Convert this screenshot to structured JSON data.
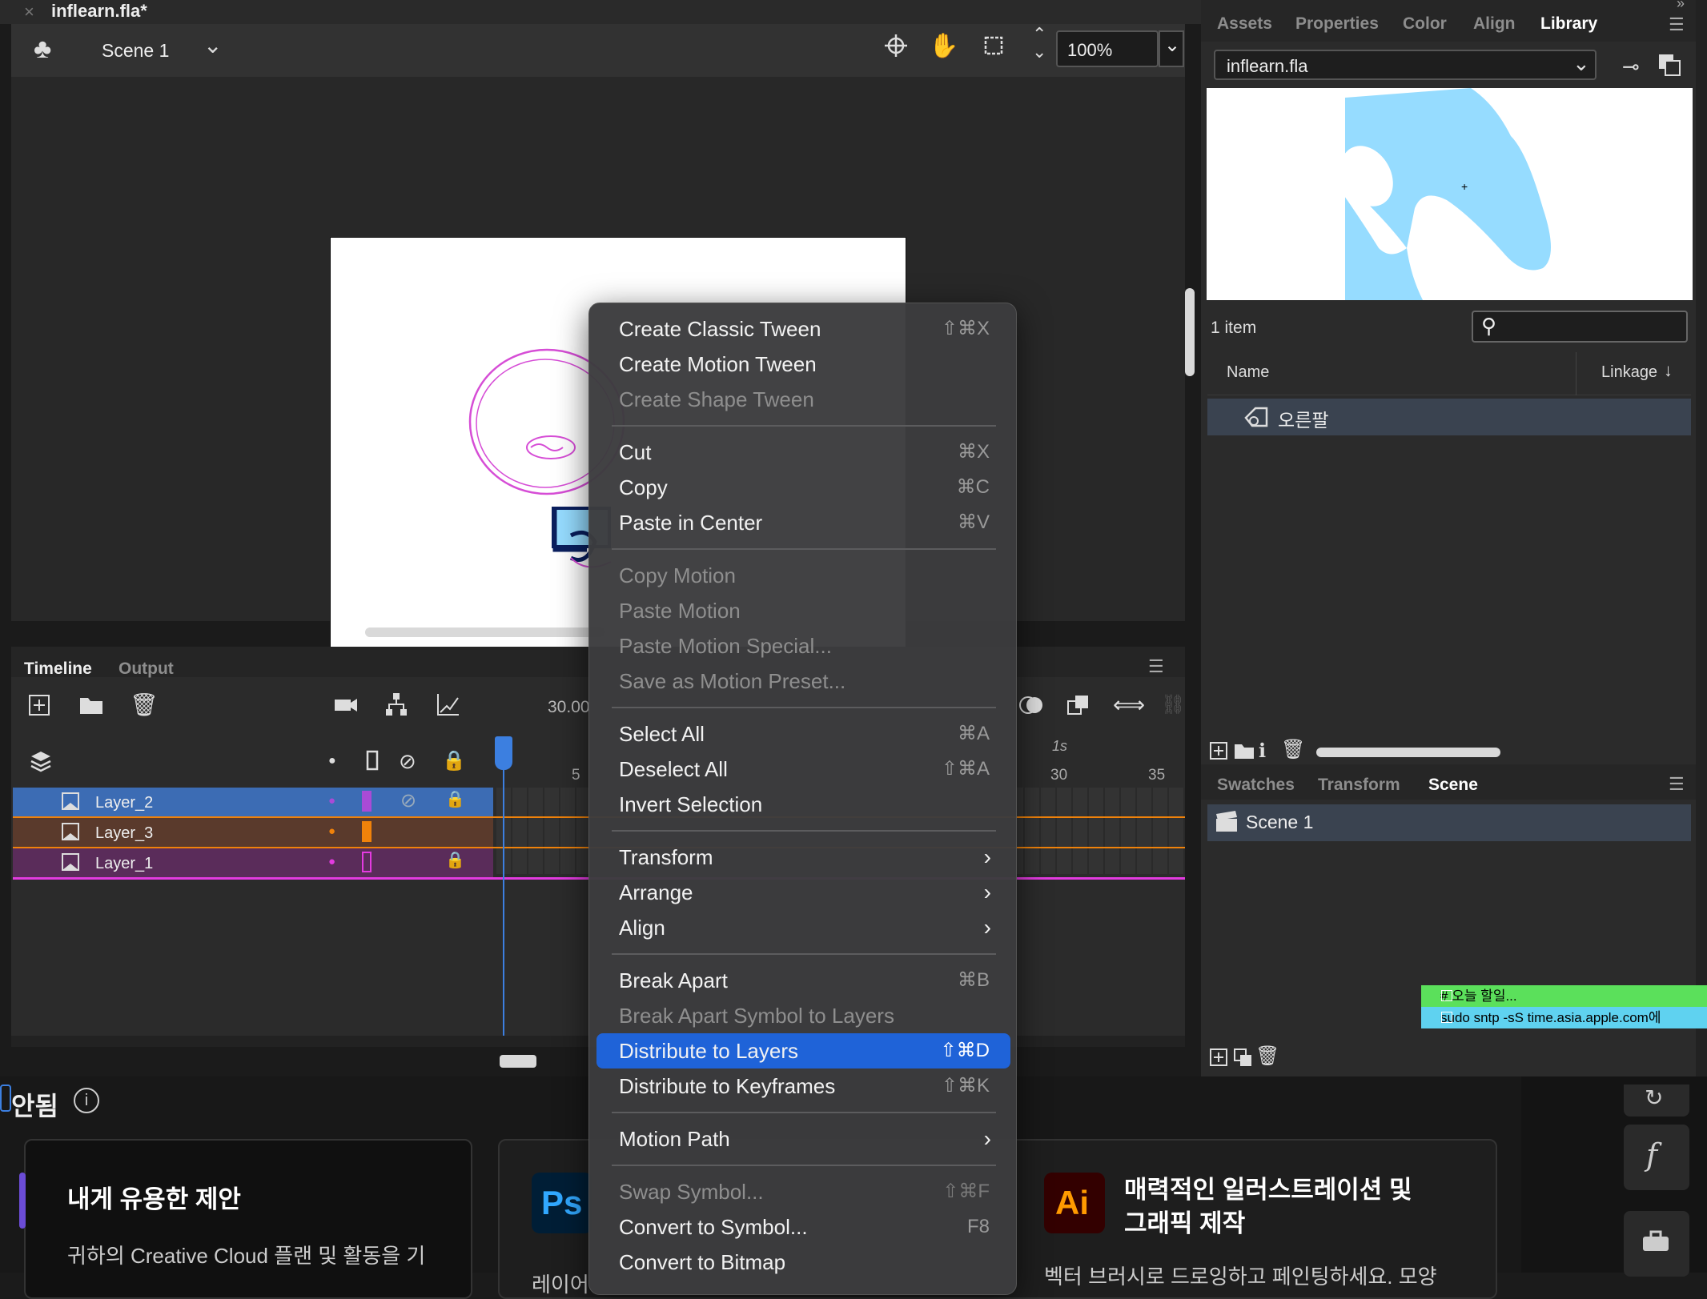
{
  "document": {
    "tab_title": "inflearn.fla*"
  },
  "editbar": {
    "scene_label": "Scene 1",
    "zoom_value": "100%"
  },
  "timeline": {
    "tabs": [
      "Timeline",
      "Output"
    ],
    "fps_readout": "30.00",
    "frame_marks": {
      "label_1s": "1s",
      "f5": "5",
      "f30": "30",
      "f35": "35"
    },
    "layers": [
      {
        "name": "Layer_2",
        "color": "#a94bd6",
        "selected": true
      },
      {
        "name": "Layer_3",
        "color": "#f0820a",
        "selected": false
      },
      {
        "name": "Layer_1",
        "color": "#e33be0",
        "selected": false
      }
    ]
  },
  "panel_tabs": [
    "Assets",
    "Properties",
    "Color",
    "Align",
    "Library"
  ],
  "library": {
    "file": "inflearn.fla",
    "item_count": "1 item",
    "col_name": "Name",
    "col_linkage": "Linkage",
    "items": [
      "오른팔"
    ]
  },
  "lower_tabs": [
    "Swatches",
    "Transform",
    "Scene"
  ],
  "scene_list": [
    "Scene 1"
  ],
  "sticky_notes": [
    "# 오늘 할일...",
    "sudo sntp -sS time.asia.apple.com에"
  ],
  "context_menu": {
    "items": [
      {
        "label": "Create Classic Tween",
        "shortcut": "⇧⌘X",
        "disabled": false
      },
      {
        "label": "Create Motion Tween",
        "shortcut": "",
        "disabled": false
      },
      {
        "label": "Create Shape Tween",
        "shortcut": "",
        "disabled": true
      },
      {
        "label": "Cut",
        "shortcut": "⌘X",
        "disabled": false
      },
      {
        "label": "Copy",
        "shortcut": "⌘C",
        "disabled": false
      },
      {
        "label": "Paste in Center",
        "shortcut": "⌘V",
        "disabled": false
      },
      {
        "label": "Copy Motion",
        "shortcut": "",
        "disabled": true
      },
      {
        "label": "Paste Motion",
        "shortcut": "",
        "disabled": true
      },
      {
        "label": "Paste Motion Special...",
        "shortcut": "",
        "disabled": true
      },
      {
        "label": "Save as Motion Preset...",
        "shortcut": "",
        "disabled": true
      },
      {
        "label": "Select All",
        "shortcut": "⌘A",
        "disabled": false
      },
      {
        "label": "Deselect All",
        "shortcut": "⇧⌘A",
        "disabled": false
      },
      {
        "label": "Invert Selection",
        "shortcut": "",
        "disabled": false
      },
      {
        "label": "Transform",
        "shortcut": "",
        "disabled": false,
        "submenu": true
      },
      {
        "label": "Arrange",
        "shortcut": "",
        "disabled": false,
        "submenu": true
      },
      {
        "label": "Align",
        "shortcut": "",
        "disabled": false,
        "submenu": true
      },
      {
        "label": "Break Apart",
        "shortcut": "⌘B",
        "disabled": false
      },
      {
        "label": "Break Apart Symbol to Layers",
        "shortcut": "",
        "disabled": true
      },
      {
        "label": "Distribute to Layers",
        "shortcut": "⇧⌘D",
        "disabled": false,
        "highlighted": true
      },
      {
        "label": "Distribute to Keyframes",
        "shortcut": "⇧⌘K",
        "disabled": false
      },
      {
        "label": "Motion Path",
        "shortcut": "",
        "disabled": false,
        "submenu": true
      },
      {
        "label": "Swap Symbol...",
        "shortcut": "⇧⌘F",
        "disabled": true
      },
      {
        "label": "Convert to Symbol...",
        "shortcut": "F8",
        "disabled": false
      },
      {
        "label": "Convert to Bitmap",
        "shortcut": "",
        "disabled": false
      }
    ]
  },
  "creative_cloud": {
    "status_text": "안됨",
    "card1_title": "내게 유용한 제안",
    "card1_text": "귀하의 Creative Cloud 플랜 및 활동을 기",
    "card2_badge": "Ps",
    "card2_text": "레이어",
    "card3_badge": "Ai",
    "card3_title_1": "매력적인 일러스트레이션 및",
    "card3_title_2": "그래픽 제작",
    "card3_text": "벡터 브러시로 드로잉하고 페인팅하세요. 모양"
  },
  "colors": {
    "accent": "#1f63d8",
    "library_preview_fill": "#96dcff"
  }
}
